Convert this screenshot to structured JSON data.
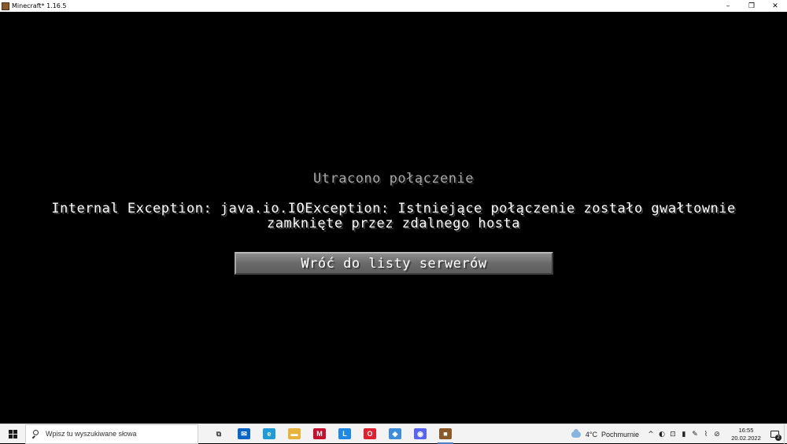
{
  "window": {
    "title": "Minecraft* 1.16.5",
    "controls": {
      "minimize": "–",
      "maximize": "❐",
      "close": "✕"
    }
  },
  "disconnect_screen": {
    "title": "Utracono połączenie",
    "message_line1": "Internal Exception: java.io.IOException: Istniejące połączenie zostało gwałtownie",
    "message_line2": "zamknięte przez zdalnego hosta",
    "back_button_label": "Wróć do listy serwerów"
  },
  "taskbar": {
    "search_placeholder": "Wpisz tu wyszukiwane słowa",
    "pinned_apps": [
      {
        "name": "task-view",
        "glyph": "⧉",
        "color": "#444444"
      },
      {
        "name": "mail",
        "glyph": "✉",
        "color": "#0a64c8"
      },
      {
        "name": "edge",
        "glyph": "e",
        "color": "#1f9bd6"
      },
      {
        "name": "file-explorer",
        "glyph": "▬",
        "color": "#e8b33a"
      },
      {
        "name": "mcafee",
        "glyph": "M",
        "color": "#c8102e"
      },
      {
        "name": "l-app",
        "glyph": "L",
        "color": "#1e88e5"
      },
      {
        "name": "opera",
        "glyph": "O",
        "color": "#e02030"
      },
      {
        "name": "app-blue",
        "glyph": "◆",
        "color": "#3d8ed8"
      },
      {
        "name": "discord",
        "glyph": "◉",
        "color": "#5865f2"
      },
      {
        "name": "minecraft",
        "glyph": "■",
        "color": "#8b5a2b"
      }
    ],
    "weather": {
      "temperature": "4°C",
      "condition": "Pochmurnie"
    },
    "tray_glyphs": [
      "^",
      "◐",
      "⊡",
      "▮",
      "✎",
      "⌇",
      "⊘"
    ],
    "clock": {
      "time": "16:55",
      "date": "20.02.2022"
    },
    "notification_count": "2"
  }
}
